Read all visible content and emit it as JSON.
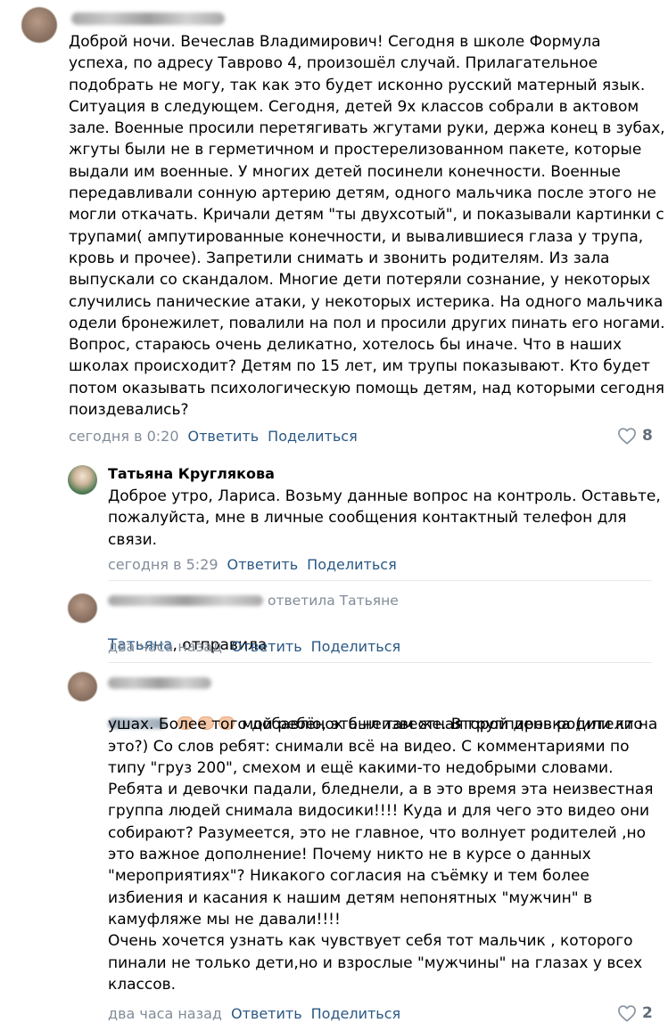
{
  "comments": [
    {
      "author": "",
      "lines": [
        "Доброй ночи. Вечеслав Владимирович! Сегодня в школе Формула",
        "успеха, по адресу Таврово 4, произошёл случай. Прилагательное",
        "подобрать не могу, так как это будет исконно русский матерный язык.",
        "Ситуация в следующем. Сегодня, детей 9х классов собрали в актовом",
        "зале. Военные просили перетягивать жгутами руки, держа конец в зубах,",
        "жгуты были не в герметичном и простерелизованном пакете, которые",
        "выдали им военные. У многих детей посинели конечности. Военные",
        "передавливали сонную артерию детям, одного мальчика после этого не",
        "могли откачать. Кричали детям \"ты двухсотый\", и показывали картинки с",
        "трупами( ампутированные конечности, и вывалившиеся глаза у трупа,",
        "кровь и прочее). Запретили снимать и звонить родителям. Из зала",
        "выпускали со скандалом. Многие дети потеряли сознание, у некоторых",
        "случились панические атаки, у некоторых истерика. На одного мальчика",
        "одели бронежилет, повалили на пол и просили других пинать его ногами.",
        "Вопрос, стараюсь очень деликатно, хотелось бы иначе. Что в наших",
        "школах происходит? Детям по 15 лет, им трупы показывают. Кто будет",
        "потом оказывать психологическую помощь детям, над которыми сегодня",
        "поиздевались?"
      ],
      "time": "сегодня в 0:20",
      "reply_label": "Ответить",
      "share_label": "Поделиться",
      "likes": "8"
    },
    {
      "author": "Татьяна Круглякова",
      "lines": [
        "Доброе утро, Лариса. Возьму данные вопрос на контроль. Оставьте,",
        "пожалуйста, мне в личные сообщения контактный телефон для",
        "связи."
      ],
      "time": "сегодня в 5:29",
      "reply_label": "Ответить",
      "share_label": "Поделиться"
    },
    {
      "author": "",
      "replied_to": "ответила Татьяне",
      "addressee": "Татьяна",
      "text_after_addressee": ", отправила",
      "time": "два часа назад",
      "reply_label": "Ответить",
      "share_label": "Поделиться"
    },
    {
      "author": "",
      "first_line_text": "мой ребёнок был там же. Второй день родители на",
      "lines": [
        "ушах. Более того добавлю, эта неизвестная группировка (или кто",
        "это?) Со слов ребят: снимали всё на видео. С комментариями по",
        "типу \"груз 200\", смехом и ещё какими-то недобрыми словами.",
        "Ребята и девочки падали, бледнели, а в это время эта неизвестная",
        "группа людей снимала видосики!!!! Куда и для чего это видео они",
        "собирают? Разумеется, это не главное, что волнует родителей ,но",
        "это важное дополнение! Почему никто не в курсе о данных",
        "\"мероприятиях\"? Никакого согласия на съёмку и тем более",
        "избиения и касания к нашим детям непонятных \"мужчин\" в",
        "камуфляже мы не давали!!!!",
        "Очень хочется узнать как чувствует себя тот мальчик , которого",
        "пинали не только дети,но и взрослые \"мужчины\" на глазах у всех",
        "классов."
      ],
      "time": "два часа назад",
      "reply_label": "Ответить",
      "share_label": "Поделиться",
      "likes": "2"
    }
  ],
  "colors": {
    "link": "#2a5885",
    "meta_gray": "#818c99",
    "divider": "#e7e8ec",
    "text": "#000000"
  },
  "icons": {
    "like": "heart-outline-icon",
    "emoji": "clapping-hands-emoji"
  }
}
